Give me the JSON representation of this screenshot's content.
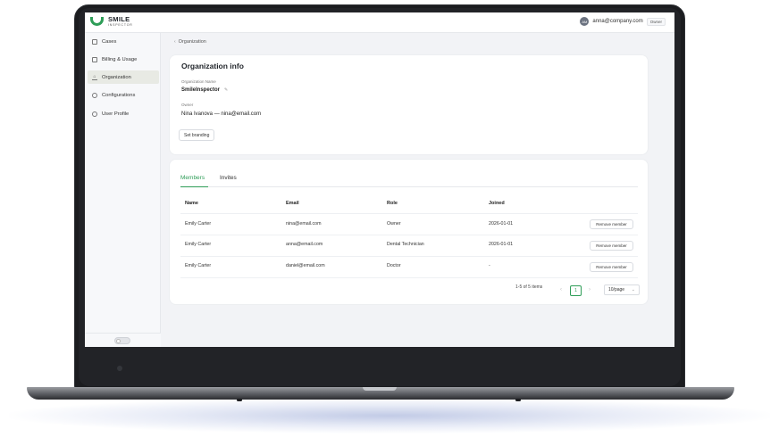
{
  "topbar": {
    "logo_title": "SMILE",
    "logo_subtitle": "INSPECTOR",
    "user_initials": "AM",
    "user_email": "anna@company.com",
    "user_role": "Owner"
  },
  "sidebar": {
    "items": [
      {
        "label": "Cases",
        "icon": "folder-icon"
      },
      {
        "label": "Billing & Usage",
        "icon": "billing-icon"
      },
      {
        "label": "Organization",
        "icon": "organization-icon",
        "active": true
      },
      {
        "label": "Configurations",
        "icon": "gear-icon"
      },
      {
        "label": "User Profile",
        "icon": "user-icon"
      }
    ]
  },
  "breadcrumb": {
    "arrow": "‹",
    "label": "Organization"
  },
  "org_info": {
    "title": "Organization info",
    "name_label": "Organization Name",
    "name_value": "SmileInspector",
    "owner_label": "Owner",
    "owner_value": "Nina Ivanova — nina@email.com",
    "branding_button": "Set branding"
  },
  "members": {
    "tabs": [
      {
        "label": "Members",
        "active": true
      },
      {
        "label": "Invites"
      }
    ],
    "columns": [
      "Name",
      "Email",
      "Role",
      "Joined"
    ],
    "rows": [
      {
        "name": "Emily Carter",
        "email": "nina@email.com",
        "role": "Owner",
        "joined": "2026-01-01",
        "action": "Remove member"
      },
      {
        "name": "Emily Carter",
        "email": "anna@email.com",
        "role": "Dental Technician",
        "joined": "2026-01-01",
        "action": "Remove member"
      },
      {
        "name": "Emily Carter",
        "email": "daniel@email.com",
        "role": "Doctor",
        "joined": "-",
        "action": "Remove member"
      }
    ],
    "pagination": {
      "summary": "1-5 of 5 items",
      "current_page": "1",
      "prev": "‹",
      "next": "›",
      "page_size": "10/page"
    }
  },
  "colors": {
    "accent": "#2e9d57",
    "active_nav": "#e8eae4"
  }
}
